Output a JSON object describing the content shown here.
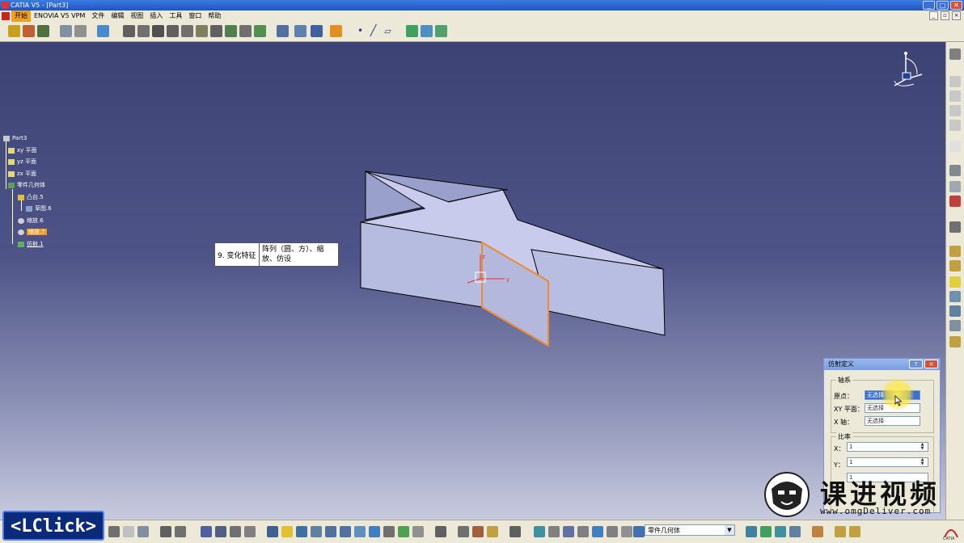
{
  "window": {
    "title": "CATIA V5 - [Part3]",
    "buttons": [
      "_",
      "□",
      "✕"
    ]
  },
  "menubar": {
    "items": [
      "开始",
      "ENOVIA V5 VPM",
      "文件",
      "编辑",
      "视图",
      "插入",
      "工具",
      "窗口",
      "帮助"
    ],
    "active_index": 0
  },
  "tree": {
    "root": "Part3",
    "items": [
      {
        "label": "xy 平面",
        "icon": "plane-icon"
      },
      {
        "label": "yz 平面",
        "icon": "plane-icon"
      },
      {
        "label": "zx 平面",
        "icon": "plane-icon"
      },
      {
        "label": "零件几何体",
        "icon": "body-icon"
      },
      {
        "label": "凸台.5",
        "icon": "pad-icon"
      },
      {
        "label": "草图.6",
        "icon": "sketch-icon"
      },
      {
        "label": "缩放.6",
        "icon": "scaling-icon"
      },
      {
        "label": "缩放.7",
        "icon": "scaling-icon",
        "selected": true
      },
      {
        "label": "仿射.1",
        "icon": "affinity-icon"
      }
    ]
  },
  "tooltip": {
    "col1": "9. 变化特征",
    "col2": "阵列（圆、方）、缩放、仿设"
  },
  "dialog": {
    "title": "仿射定义",
    "axis_group": "轴系",
    "origin_label": "原点：",
    "origin_value": "无选择",
    "xy_label": "XY 平面：",
    "xy_value": "无选择",
    "x_axis_label": "X 轴：",
    "x_axis_value": "无选择",
    "ratio_group": "比率",
    "x_label": "X：",
    "x_value": "1",
    "y_label": "Y：",
    "y_value": "1",
    "z_value": "1"
  },
  "bottom": {
    "body_combo": "零件几何体"
  },
  "overlay": {
    "lclick": "<LClick>",
    "watermark_text": "课进视频",
    "watermark_url": "www.omgDeliver.com"
  },
  "colors": {
    "viewport_top": "#3c4273",
    "selection_orange": "#f39a1f",
    "model_face": "#b8bde0",
    "model_top": "#c8cbec"
  }
}
